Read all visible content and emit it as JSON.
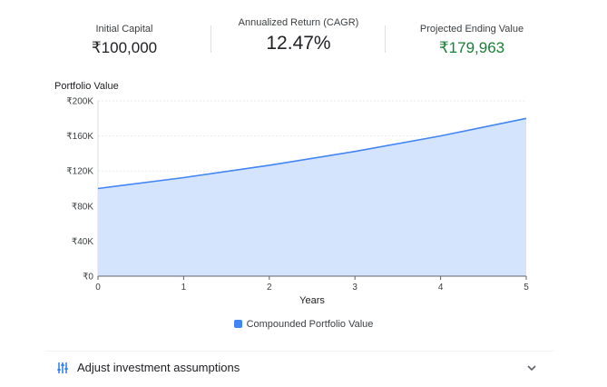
{
  "summary": {
    "initial_capital": {
      "label": "Initial Capital",
      "value": "₹100,000"
    },
    "cagr": {
      "label": "Annualized Return (CAGR)",
      "value": "12.47%"
    },
    "ending_value": {
      "label": "Projected Ending Value",
      "value": "₹179,963"
    }
  },
  "chart_title": "Portfolio Value",
  "legend_label": "Compounded Portfolio Value",
  "accordion": {
    "label": "Adjust investment assumptions"
  },
  "icons": {
    "sliders": "tune-icon",
    "chevron": "chevron-down-icon"
  },
  "colors": {
    "accent": "#4285f4",
    "area_fill": "#d2e3fc",
    "positive": "#188038"
  },
  "chart_data": {
    "type": "area",
    "x": [
      0,
      1,
      2,
      3,
      4,
      5
    ],
    "series": [
      {
        "name": "Compounded Portfolio Value",
        "values": [
          100000,
          112470,
          126495,
          142268,
          160008,
          179963
        ]
      }
    ],
    "xlabel": "Years",
    "ylabel": "Portfolio Value",
    "xlim": [
      0,
      5
    ],
    "ylim": [
      0,
      200000
    ],
    "x_ticks": [
      "0",
      "1",
      "2",
      "3",
      "4",
      "5"
    ],
    "y_ticks": [
      {
        "value": 0,
        "label": "₹0"
      },
      {
        "value": 40000,
        "label": "₹40K"
      },
      {
        "value": 80000,
        "label": "₹80K"
      },
      {
        "value": 120000,
        "label": "₹120K"
      },
      {
        "value": 160000,
        "label": "₹160K"
      },
      {
        "value": 200000,
        "label": "₹200K"
      }
    ],
    "grid": true,
    "legend_position": "bottom"
  }
}
